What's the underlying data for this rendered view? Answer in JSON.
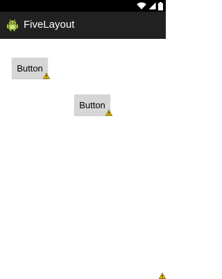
{
  "app": {
    "title": "FiveLayout",
    "icon": "android-icon"
  },
  "status_bar": {
    "icons": [
      "wifi-icon",
      "signal-icon",
      "battery-icon"
    ]
  },
  "buttons": [
    {
      "label": "Button",
      "warning_icon": "warning-icon"
    },
    {
      "label": "Button",
      "warning_icon": "warning-icon"
    }
  ],
  "colors": {
    "status_bar": "#000000",
    "action_bar": "#212121",
    "button": "#d6d6d6",
    "background": "#ffffff",
    "warning": "#f2c200"
  }
}
